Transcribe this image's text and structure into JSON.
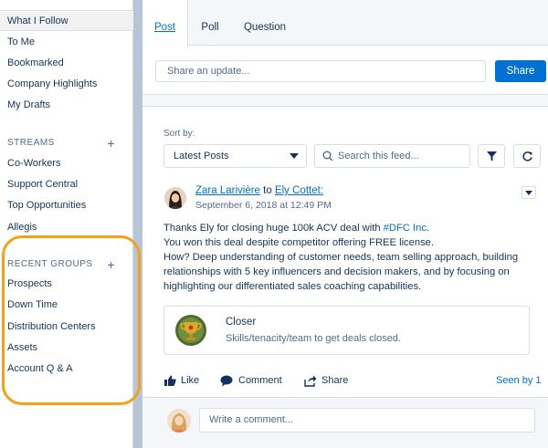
{
  "sidebar": {
    "items": [
      {
        "label": "What I Follow"
      },
      {
        "label": "To Me"
      },
      {
        "label": "Bookmarked"
      },
      {
        "label": "Company Highlights"
      },
      {
        "label": "My Drafts"
      }
    ],
    "streams": {
      "heading": "STREAMS",
      "add": "+",
      "items": [
        {
          "label": "Co-Workers"
        },
        {
          "label": "Support Central"
        },
        {
          "label": "Top Opportunities"
        },
        {
          "label": "Allegis"
        }
      ]
    },
    "groups": {
      "heading": "RECENT GROUPS",
      "add": "+",
      "items": [
        {
          "label": "Prospects"
        },
        {
          "label": "Down Time"
        },
        {
          "label": "Distribution Centers"
        },
        {
          "label": "Assets"
        },
        {
          "label": "Account Q & A"
        }
      ]
    }
  },
  "publisher": {
    "tabs": [
      {
        "label": "Post"
      },
      {
        "label": "Poll"
      },
      {
        "label": "Question"
      }
    ],
    "placeholder": "Share an update...",
    "share_label": "Share"
  },
  "feed": {
    "sort_label": "Sort by:",
    "sort_value": "Latest Posts",
    "search_placeholder": "Search this feed...",
    "post": {
      "author": "Zara Larivière",
      "to_word": "to",
      "recipient": "Ely Cottet:",
      "date": "September 6, 2018 at 12:49 PM",
      "line1_pre": "Thanks Ely for closing huge 100k ACV deal with ",
      "hashtag": "#DFC Inc",
      "line1_post": ".",
      "line2": "You won this deal despite competitor offering FREE license.",
      "line3": "How? Deep understanding of customer needs, team selling approach, building",
      "line4": "relationships with 5 key influencers and decision makers, and by focusing on",
      "line5": "highlighting our differentiated sales coaching capabilities.",
      "badge": {
        "title": "Closer",
        "description": "Skills/tenacity/team to get deals closed."
      },
      "actions": {
        "like": "Like",
        "comment": "Comment",
        "share": "Share",
        "seen": "Seen by 1"
      },
      "comment_placeholder": "Write a comment..."
    }
  },
  "colors": {
    "accent": "#0070d2",
    "highlight_ring": "#f4a11a",
    "gutter": "#b7c5d9"
  }
}
